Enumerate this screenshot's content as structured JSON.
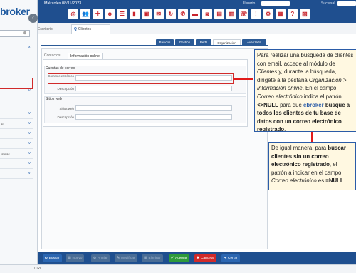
{
  "app": {
    "logo_text": "broker"
  },
  "header": {
    "date": "Miércoles 08/11/2023",
    "user_label": "Usuario",
    "branch_label": "Sucursal",
    "toolbar_icons": [
      "target-icon",
      "users-icon",
      "user-add-icon",
      "user-group-icon",
      "tasks-icon",
      "chart-icon",
      "inbox-icon",
      "mail-icon",
      "refresh-icon",
      "message-icon",
      "folder-icon",
      "cart-icon",
      "document-icon",
      "report-icon",
      "phone-icon",
      "alert-icon",
      "settings-icon",
      "grid-icon",
      "help-icon",
      "calendar-icon"
    ]
  },
  "sidebar": {
    "rows": [
      {
        "label": ""
      },
      {
        "label": ""
      },
      {
        "label": ""
      },
      {
        "label": "al"
      },
      {
        "label": ""
      },
      {
        "label": ""
      },
      {
        "label": "ísticas"
      },
      {
        "label": ""
      },
      {
        "label": ""
      }
    ]
  },
  "tabs": [
    {
      "label": "Escritorio"
    },
    {
      "label": "Clientes"
    }
  ],
  "section_tabs": [
    "Básicos",
    "Gestión",
    "Perfil",
    "Organización",
    "Avanzada"
  ],
  "panel_tabs": [
    "Contactos",
    "Información online"
  ],
  "email_group": {
    "title": "Cuentas de correo",
    "email_label": "Correo electrónico",
    "description_label": "Descripción"
  },
  "web_group": {
    "title": "Sitios web",
    "sites_label": "Sitios web",
    "description_label": "Descripción"
  },
  "bottom_buttons": [
    {
      "label": "Buscar",
      "icon": "search-icon"
    },
    {
      "label": "Nuevo",
      "icon": "new-icon"
    },
    {
      "label": "Anular",
      "icon": "cancel-icon"
    },
    {
      "label": "Modificar",
      "icon": "edit-icon"
    },
    {
      "label": "Eliminar",
      "icon": "delete-icon"
    },
    {
      "label": "Aceptar",
      "icon": "check-icon"
    },
    {
      "label": "Cancelar",
      "icon": "x-icon"
    },
    {
      "label": "Cerrar",
      "icon": "exit-icon"
    }
  ],
  "status": "11RL",
  "callouts": {
    "c1": {
      "p1": "Para realizar una búsqueda de clientes con email, accede al módulo de ",
      "clientes": "Clientes",
      "p2": " y, durante la búsqueda, dirígete a la pestaña ",
      "tab_name": "Organización > Información online",
      "p3": ". En el campo ",
      "field": "Correo electrónico",
      "p4": " indica el patrón ",
      "pattern": "<>NULL",
      "p5": " para que ",
      "brand": "ebroker",
      "p6": "busque a todos los clientes de tu base de datos con un correo electrónico registrado",
      "p7": "."
    },
    "c2": {
      "p1": "De igual manera, para ",
      "b1": "buscar clientes sin un correo electrónico registrado",
      "p2": ", el patrón a indicar en el campo ",
      "field": "Correo electrónico",
      "p3": " es ",
      "pattern": "=NULL",
      "p4": "."
    }
  },
  "colors": {
    "topbar": "#1f4f8f",
    "accent": "#2b5a96",
    "highlight": "#d12a2a",
    "callout_bg": "#fff8e1",
    "accept": "#2e9a3a",
    "cancel": "#d12a2a"
  }
}
